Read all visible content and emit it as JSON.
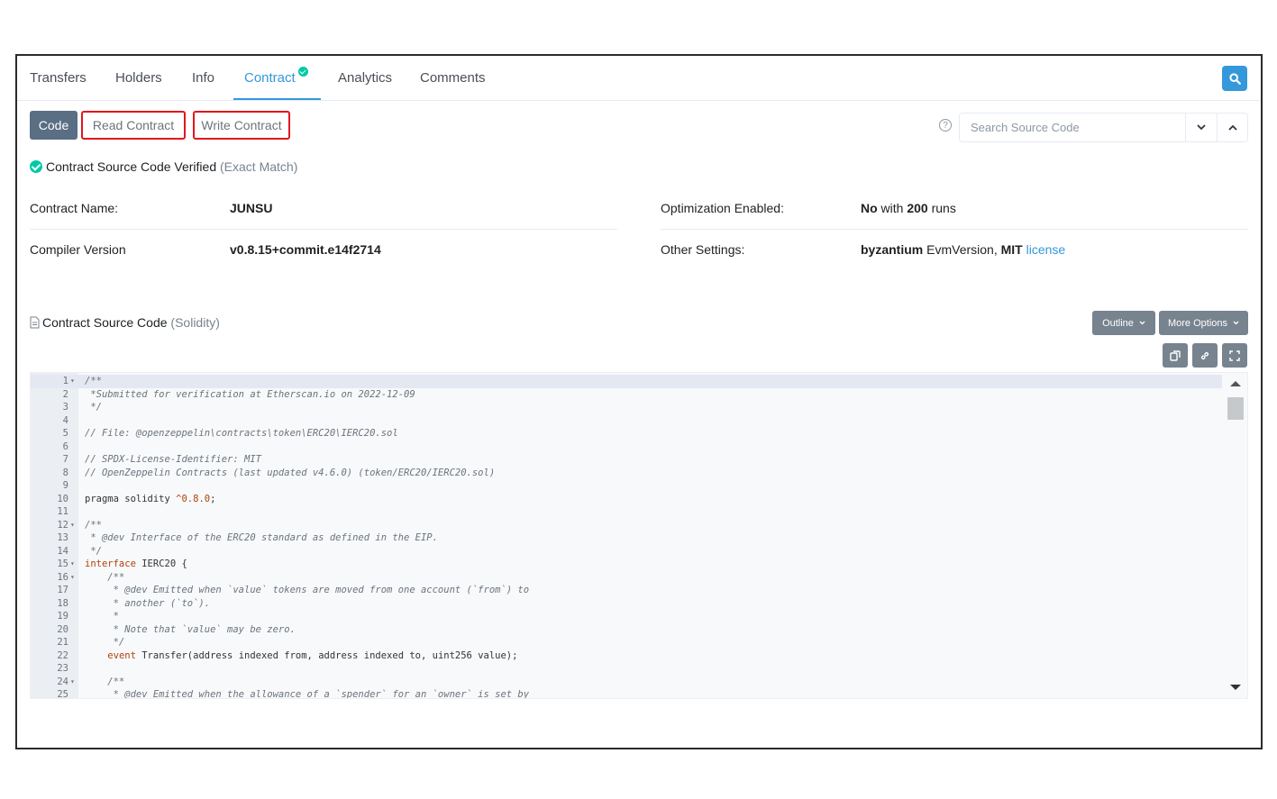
{
  "tabs": [
    {
      "label": "Transfers"
    },
    {
      "label": "Holders"
    },
    {
      "label": "Info"
    },
    {
      "label": "Contract",
      "active": true
    },
    {
      "label": "Analytics"
    },
    {
      "label": "Comments"
    }
  ],
  "subtabs": {
    "code": "Code",
    "read": "Read Contract",
    "write": "Write Contract"
  },
  "search": {
    "placeholder": "Search Source Code",
    "help_icon": "?"
  },
  "verified": {
    "title": "Contract Source Code Verified",
    "match": "(Exact Match)"
  },
  "info": {
    "contract_name_label": "Contract Name:",
    "contract_name": "JUNSU",
    "optimization_label": "Optimization Enabled:",
    "optimization_prefix": "No",
    "optimization_mid": " with ",
    "optimization_runs": "200",
    "optimization_suffix": " runs",
    "compiler_label": "Compiler Version",
    "compiler_value": "v0.8.15+commit.e14f2714",
    "other_label": "Other Settings:",
    "other_evm": "byzantium",
    "other_mid": " EvmVersion, ",
    "other_license": "MIT",
    "other_link": "license"
  },
  "source": {
    "title": "Contract Source Code",
    "lang": "(Solidity)",
    "outline": "Outline",
    "more_options": "More Options"
  },
  "code_lines": [
    {
      "n": "1",
      "fold": "▾",
      "t": "/**",
      "c": "comment"
    },
    {
      "n": "2",
      "fold": "",
      "t": " *Submitted for verification at Etherscan.io on 2022-12-09",
      "c": "comment"
    },
    {
      "n": "3",
      "fold": "",
      "t": " */",
      "c": "comment"
    },
    {
      "n": "4",
      "fold": "",
      "t": "",
      "c": ""
    },
    {
      "n": "5",
      "fold": "",
      "t": "// File: @openzeppelin\\contracts\\token\\ERC20\\IERC20.sol",
      "c": "comment"
    },
    {
      "n": "6",
      "fold": "",
      "t": "",
      "c": ""
    },
    {
      "n": "7",
      "fold": "",
      "t": "// SPDX-License-Identifier: MIT",
      "c": "comment"
    },
    {
      "n": "8",
      "fold": "",
      "t": "// OpenZeppelin Contracts (last updated v4.6.0) (token/ERC20/IERC20.sol)",
      "c": "comment"
    },
    {
      "n": "9",
      "fold": "",
      "t": "",
      "c": ""
    },
    {
      "n": "10",
      "fold": "",
      "t": "pragma solidity ^0.8.0;",
      "c": "pragma"
    },
    {
      "n": "11",
      "fold": "",
      "t": "",
      "c": ""
    },
    {
      "n": "12",
      "fold": "▾",
      "t": "/**",
      "c": "comment"
    },
    {
      "n": "13",
      "fold": "",
      "t": " * @dev Interface of the ERC20 standard as defined in the EIP.",
      "c": "comment"
    },
    {
      "n": "14",
      "fold": "",
      "t": " */",
      "c": "comment"
    },
    {
      "n": "15",
      "fold": "▾",
      "t": "interface IERC20 {",
      "c": "interface"
    },
    {
      "n": "16",
      "fold": "▾",
      "t": "    /**",
      "c": "comment"
    },
    {
      "n": "17",
      "fold": "",
      "t": "     * @dev Emitted when `value` tokens are moved from one account (`from`) to",
      "c": "comment"
    },
    {
      "n": "18",
      "fold": "",
      "t": "     * another (`to`).",
      "c": "comment"
    },
    {
      "n": "19",
      "fold": "",
      "t": "     *",
      "c": "comment"
    },
    {
      "n": "20",
      "fold": "",
      "t": "     * Note that `value` may be zero.",
      "c": "comment"
    },
    {
      "n": "21",
      "fold": "",
      "t": "     */",
      "c": "comment"
    },
    {
      "n": "22",
      "fold": "",
      "t": "    event Transfer(address indexed from, address indexed to, uint256 value);",
      "c": "event"
    },
    {
      "n": "23",
      "fold": "",
      "t": "",
      "c": ""
    },
    {
      "n": "24",
      "fold": "▾",
      "t": "    /**",
      "c": "comment"
    },
    {
      "n": "25",
      "fold": "",
      "t": "     * @dev Emitted when the allowance of a `spender` for an `owner` is set by",
      "c": "comment"
    }
  ],
  "colors": {
    "accent": "#3498db",
    "verified": "#00c9a7",
    "highlight_box": "#e2171c",
    "button_gray": "#77838f"
  }
}
